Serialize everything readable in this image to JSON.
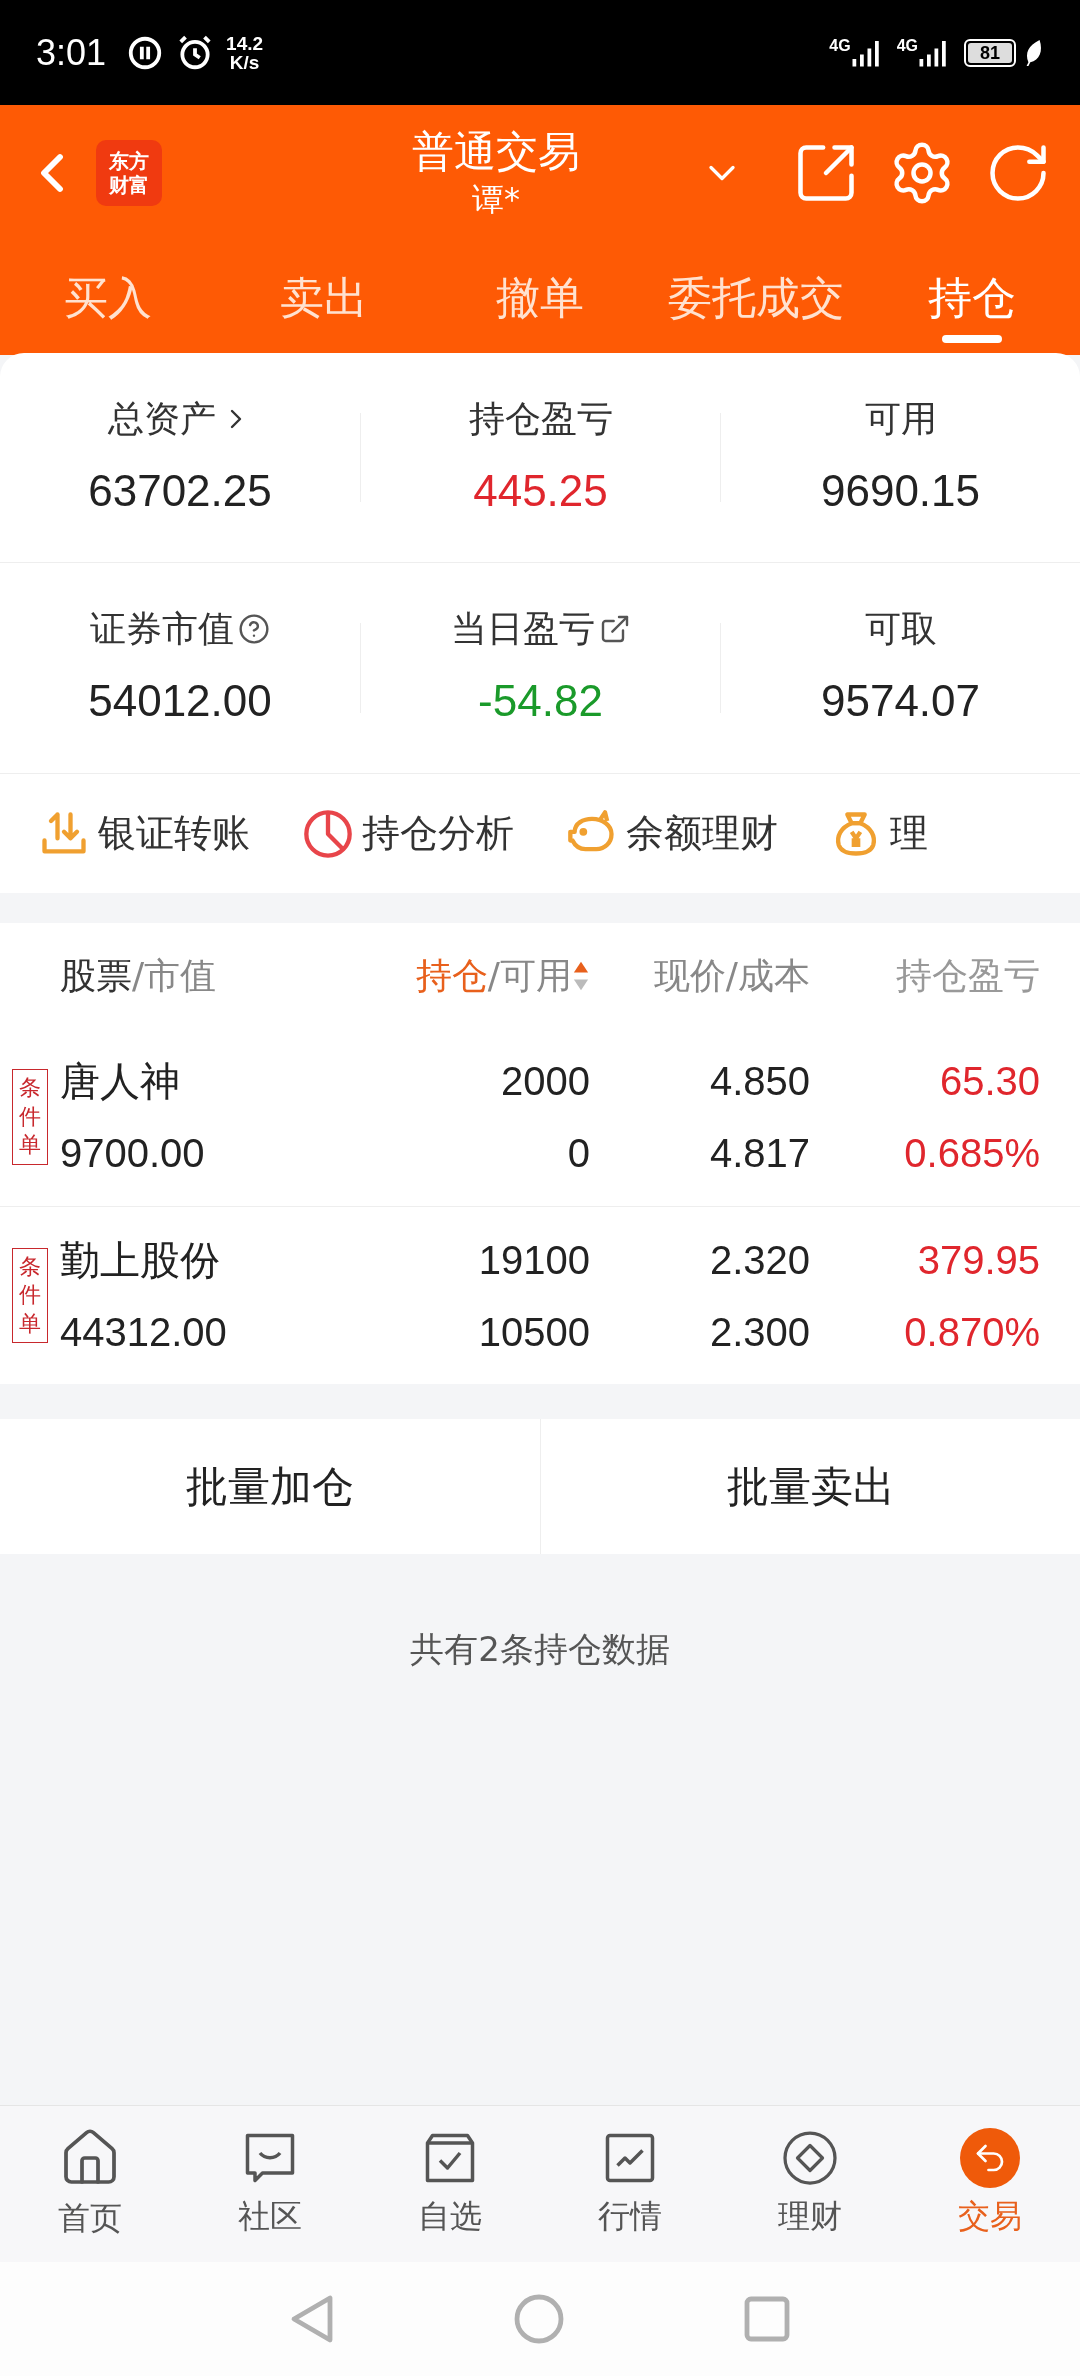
{
  "status_bar": {
    "time": "3:01",
    "speed": "14.2",
    "speed_unit": "K/s",
    "networks": [
      "4G",
      "4G"
    ],
    "battery": "81"
  },
  "header": {
    "logo_lines": [
      "东方",
      "财富"
    ],
    "title": "普通交易",
    "subtitle": "谭*"
  },
  "tabs": [
    {
      "label": "买入",
      "selected": false
    },
    {
      "label": "卖出",
      "selected": false
    },
    {
      "label": "撤单",
      "selected": false
    },
    {
      "label": "委托成交",
      "selected": false
    },
    {
      "label": "持仓",
      "selected": true
    }
  ],
  "summary": [
    {
      "label": "总资产",
      "kind": "link",
      "value": "63702.25",
      "color": "#222222"
    },
    {
      "label": "持仓盈亏",
      "kind": "plain",
      "value": "445.25",
      "color": "#e0262d"
    },
    {
      "label": "可用",
      "kind": "plain",
      "value": "9690.15",
      "color": "#222222"
    },
    {
      "label": "证券市值",
      "kind": "help",
      "value": "54012.00",
      "color": "#222222"
    },
    {
      "label": "当日盈亏",
      "kind": "external",
      "value": "-54.82",
      "color": "#1a9a2a"
    },
    {
      "label": "可取",
      "kind": "plain",
      "value": "9574.07",
      "color": "#222222"
    }
  ],
  "shortcuts": [
    {
      "label": "银证转账",
      "kind": "transfer"
    },
    {
      "label": "持仓分析",
      "kind": "pie"
    },
    {
      "label": "余额理财",
      "kind": "piggy"
    },
    {
      "label": "理",
      "kind": "moneybag"
    }
  ],
  "table": {
    "columns": [
      {
        "label": "股票",
        "secondary": "/市值",
        "sorted": false
      },
      {
        "label": "持仓",
        "secondary": "/可用",
        "sorted": true
      },
      {
        "secondary": "现价/成本",
        "sorted": false
      },
      {
        "secondary": "持仓盈亏",
        "sorted": false
      }
    ],
    "rows": [
      {
        "tag": "条件单",
        "name": "唐人神",
        "market_value": "9700.00",
        "holding": "2000",
        "available": "0",
        "price": "4.850",
        "cost": "4.817",
        "pnl": "65.30",
        "pnl_pct": "0.685%",
        "color": "#e0262d"
      },
      {
        "tag": "条件单",
        "name": "勤上股份",
        "market_value": "44312.00",
        "holding": "19100",
        "available": "10500",
        "price": "2.320",
        "cost": "2.300",
        "pnl": "379.95",
        "pnl_pct": "0.870%",
        "color": "#e0262d"
      }
    ]
  },
  "batch_buttons": [
    "批量加仓",
    "批量卖出"
  ],
  "footer_note": "共有2条持仓数据",
  "bottom_nav": [
    {
      "label": "首页",
      "kind": "home",
      "selected": false
    },
    {
      "label": "社区",
      "kind": "chat",
      "selected": false
    },
    {
      "label": "自选",
      "kind": "check",
      "selected": false
    },
    {
      "label": "行情",
      "kind": "chart",
      "selected": false
    },
    {
      "label": "理财",
      "kind": "diamond",
      "selected": false
    },
    {
      "label": "交易",
      "kind": "trade",
      "selected": true
    }
  ]
}
